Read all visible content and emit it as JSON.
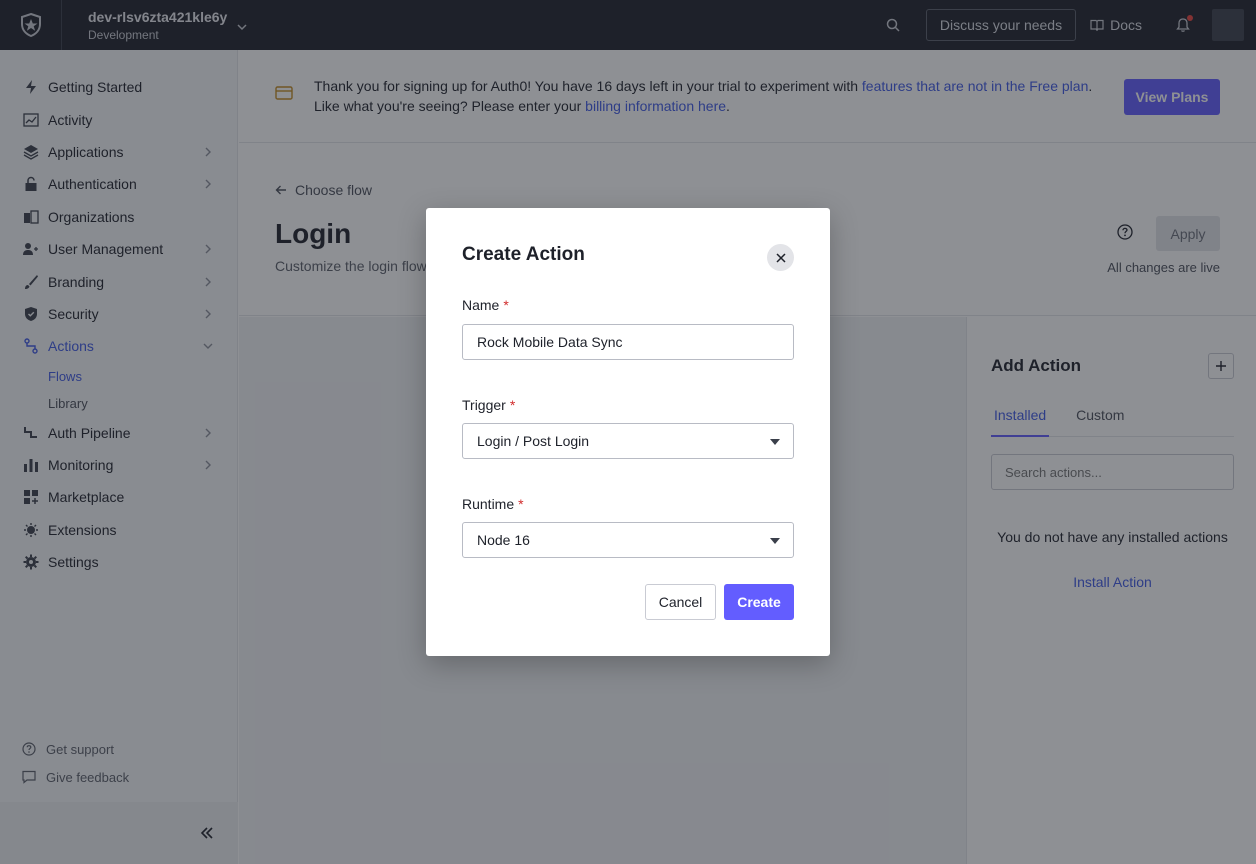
{
  "topbar": {
    "tenant_name": "dev-rlsv6zta421kle6y",
    "tenant_env": "Development",
    "discuss_label": "Discuss your needs",
    "docs_label": "Docs"
  },
  "sidebar": {
    "items": [
      {
        "label": "Getting Started",
        "icon": "bolt-icon"
      },
      {
        "label": "Activity",
        "icon": "activity-chart-icon"
      },
      {
        "label": "Applications",
        "icon": "layers-icon"
      },
      {
        "label": "Authentication",
        "icon": "lock-icon"
      },
      {
        "label": "Organizations",
        "icon": "building-icon"
      },
      {
        "label": "User Management",
        "icon": "users-icon"
      },
      {
        "label": "Branding",
        "icon": "brush-icon"
      },
      {
        "label": "Security",
        "icon": "shield-icon"
      },
      {
        "label": "Actions",
        "icon": "flow-icon"
      },
      {
        "label": "Auth Pipeline",
        "icon": "pipeline-icon"
      },
      {
        "label": "Monitoring",
        "icon": "bar-chart-icon"
      },
      {
        "label": "Marketplace",
        "icon": "grid-plus-icon"
      },
      {
        "label": "Extensions",
        "icon": "puzzle-icon"
      },
      {
        "label": "Settings",
        "icon": "gear-icon"
      }
    ],
    "subitems": [
      {
        "label": "Flows"
      },
      {
        "label": "Library"
      }
    ],
    "get_support": "Get support",
    "give_feedback": "Give feedback"
  },
  "banner": {
    "line1_prefix": "Thank you for signing up for Auth0! You have 16 days left in your trial to experiment with ",
    "line1_link": "features that are not in the Free plan",
    "line1_suffix": ".",
    "line2_prefix": "Like what you're seeing? Please enter your ",
    "line2_link": "billing information here",
    "line2_suffix": ".",
    "view_plans": "View Plans"
  },
  "page": {
    "back_label": "Choose flow",
    "title": "Login",
    "subtitle": "Customize the login flow",
    "apply_label": "Apply",
    "live_text": "All changes are live"
  },
  "right_panel": {
    "title": "Add Action",
    "tabs": [
      "Installed",
      "Custom"
    ],
    "search_placeholder": "Search actions...",
    "empty_text": "You do not have any installed actions",
    "install_link": "Install Action"
  },
  "modal": {
    "title": "Create Action",
    "name_label": "Name",
    "name_value": "Rock Mobile Data Sync",
    "trigger_label": "Trigger",
    "trigger_value": "Login / Post Login",
    "runtime_label": "Runtime",
    "runtime_value": "Node 16",
    "required_mark": "*",
    "cancel_label": "Cancel",
    "create_label": "Create"
  },
  "colors": {
    "accent": "#635dff",
    "link": "#3f59e4",
    "topbar": "#1e212a",
    "required": "#d12c2c"
  }
}
